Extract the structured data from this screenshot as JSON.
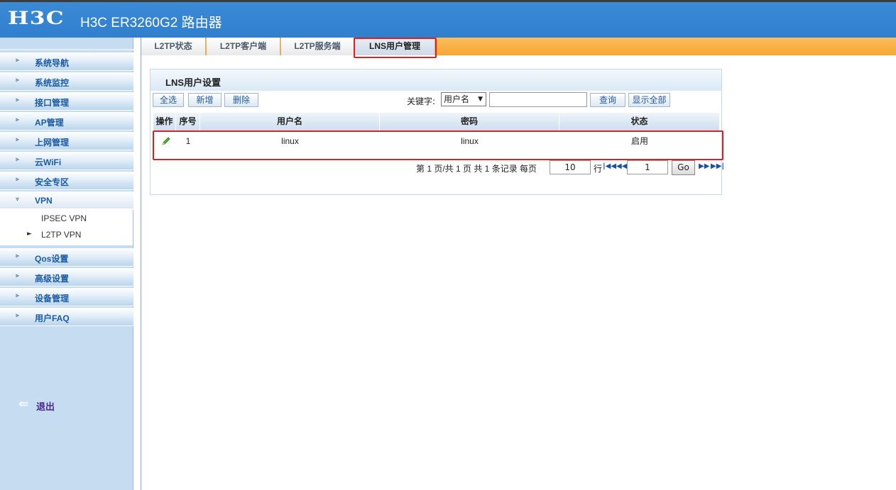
{
  "header": {
    "logo": "H3C",
    "title": "H3C ER3260G2 路由器"
  },
  "sidebar": {
    "items": [
      {
        "label": "系统导航"
      },
      {
        "label": "系统监控"
      },
      {
        "label": "接口管理"
      },
      {
        "label": "AP管理"
      },
      {
        "label": "上网管理"
      },
      {
        "label": "云WiFi"
      },
      {
        "label": "安全专区"
      },
      {
        "label": "VPN"
      },
      {
        "label": "Qos设置"
      },
      {
        "label": "高级设置"
      },
      {
        "label": "设备管理"
      },
      {
        "label": "用户FAQ"
      }
    ],
    "submenu": [
      {
        "label": "IPSEC VPN"
      },
      {
        "label": "L2TP VPN"
      }
    ],
    "logout_label": "退出"
  },
  "tabs": [
    {
      "label": "L2TP状态"
    },
    {
      "label": "L2TP客户端"
    },
    {
      "label": "L2TP服务端"
    },
    {
      "label": "LNS用户管理"
    }
  ],
  "panel": {
    "title": "LNS用户设置",
    "buttons": {
      "select_all": "全选",
      "add": "新增",
      "delete": "删除",
      "query": "查询",
      "show_all": "显示全部"
    },
    "keyword_label": "关键字:",
    "keyword_select": "用户名",
    "keyword_value": "",
    "table": {
      "headers": [
        "操作",
        "序号",
        "用户名",
        "密码",
        "状态"
      ],
      "rows": [
        {
          "index": "1",
          "username": "linux",
          "password": "linux",
          "status": "启用"
        }
      ]
    },
    "pager": {
      "text": "第 1 页/共 1 页 共 1 条记录 每页",
      "per_page": "10",
      "rows_label": "行",
      "page": "1",
      "go": "Go"
    }
  }
}
